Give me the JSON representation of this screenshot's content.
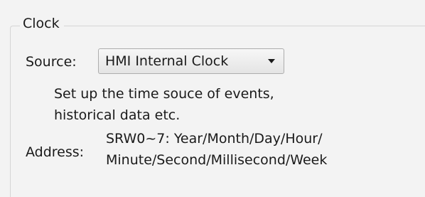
{
  "clock": {
    "group_title": "Clock",
    "source_label": "Source:",
    "source_value": "HMI Internal Clock",
    "description_lines": [
      "Set up the time souce of events,",
      "historical data etc."
    ],
    "address_label": "Address:",
    "address_lines": [
      "SRW0~7: Year/Month/Day/Hour/",
      "Minute/Second/Millisecond/Week"
    ]
  },
  "colors": {
    "background": "#f3f3f3",
    "frame": "#d5d5d5",
    "combo_border": "#adadad"
  }
}
